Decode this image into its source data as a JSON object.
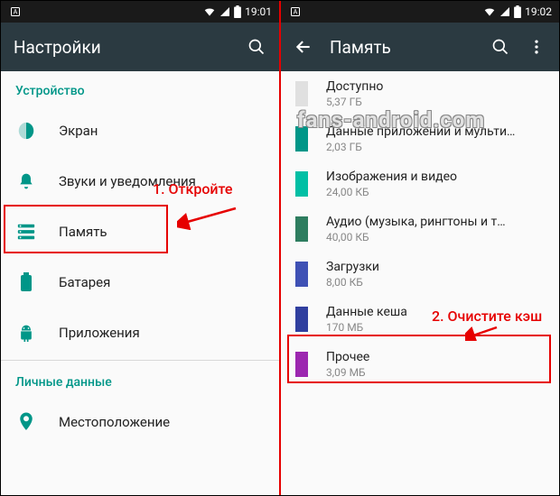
{
  "left": {
    "status_time": "19:01",
    "app_title": "Настройки",
    "sections": {
      "device_header": "Устройство",
      "personal_header": "Личные данные"
    },
    "items": {
      "display": "Экран",
      "sound": "Звуки и уведомления",
      "memory": "Память",
      "battery": "Батарея",
      "apps": "Приложения",
      "location": "Местоположение"
    },
    "annotation": "1. Откройте"
  },
  "right": {
    "status_time": "19:02",
    "app_title": "Память",
    "storage": {
      "available": {
        "label": "Доступно",
        "value": "5,37 ГБ",
        "color": "#e0e0e0"
      },
      "apps": {
        "label": "Данные приложений и мульти…",
        "value": "2,03 ГБ",
        "color": "#009688"
      },
      "images": {
        "label": "Изображения и видео",
        "value": "24,00 КБ",
        "color": "#00bfa5"
      },
      "audio": {
        "label": "Аудио (музыка, рингтоны и т…",
        "value": "40,00 КБ",
        "color": "#2e7d5f"
      },
      "downloads": {
        "label": "Загрузки",
        "value": "8,00 КБ",
        "color": "#3f51b5"
      },
      "cache": {
        "label": "Данные кеша",
        "value": "170 МБ",
        "color": "#303f9f"
      },
      "misc": {
        "label": "Прочее",
        "value": "3,09 МБ",
        "color": "#9c27b0"
      }
    },
    "annotation": "2. Очистите кэш"
  },
  "watermark": "fans-android.com"
}
